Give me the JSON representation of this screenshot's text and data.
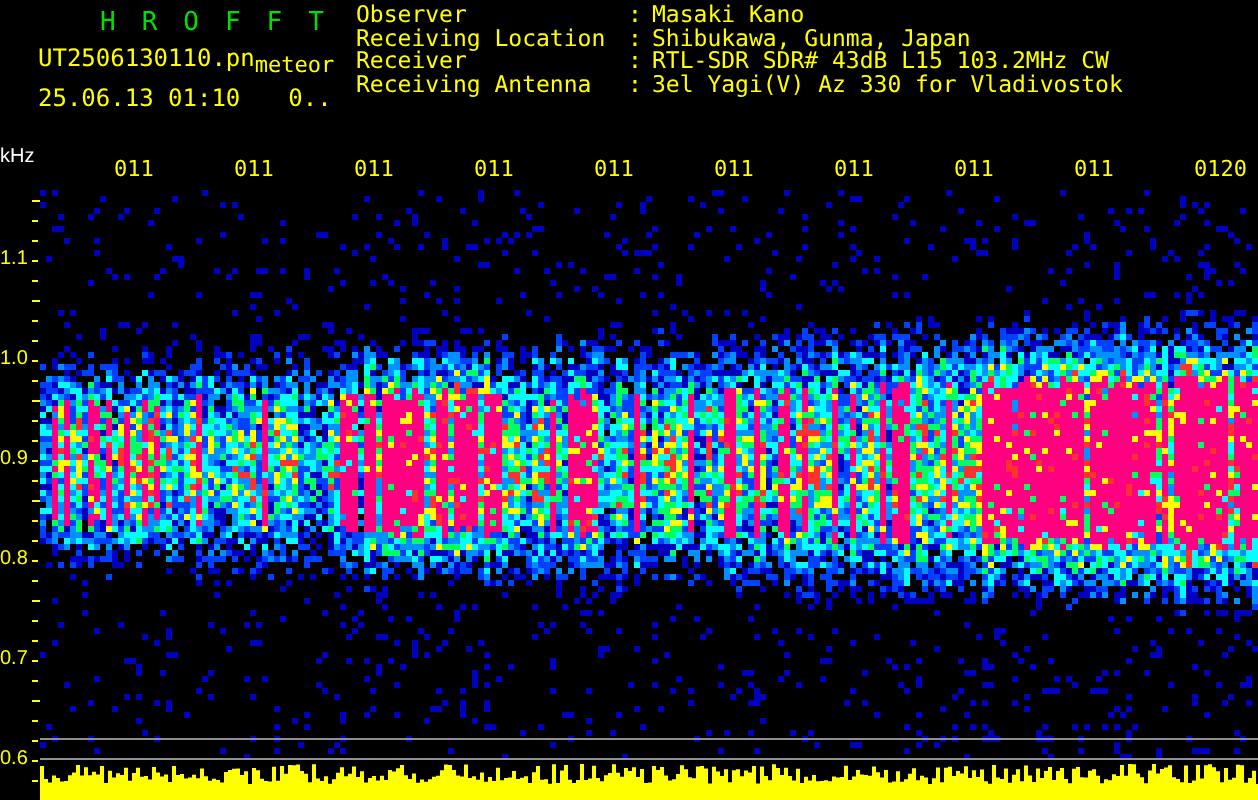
{
  "header": {
    "title": "HROFFT",
    "file_name": "UT2506130110.pn",
    "tag": "meteor",
    "timestamp": "25.06.13 01:10",
    "counter": "0.."
  },
  "info": [
    {
      "label": "Observer",
      "separator": ":",
      "value": "Masaki Kano"
    },
    {
      "label": "Receiving Location",
      "separator": ":",
      "value": "Shibukawa, Gunma, Japan"
    },
    {
      "label": "Receiver",
      "separator": ":",
      "value": "RTL-SDR SDR# 43dB L15 103.2MHz CW"
    },
    {
      "label": "Receiving Antenna",
      "separator": ":",
      "value": "3el Yagi(V) Az 330 for Vladivostok"
    }
  ],
  "axis_unit": "kHz",
  "time_labels": [
    "011",
    "011",
    "011",
    "011",
    "011",
    "011",
    "011",
    "011",
    "011",
    "0120"
  ],
  "frequency_labels": [
    "1.1",
    "1.0",
    "0.9",
    "0.8",
    "0.7",
    "0.6"
  ]
}
